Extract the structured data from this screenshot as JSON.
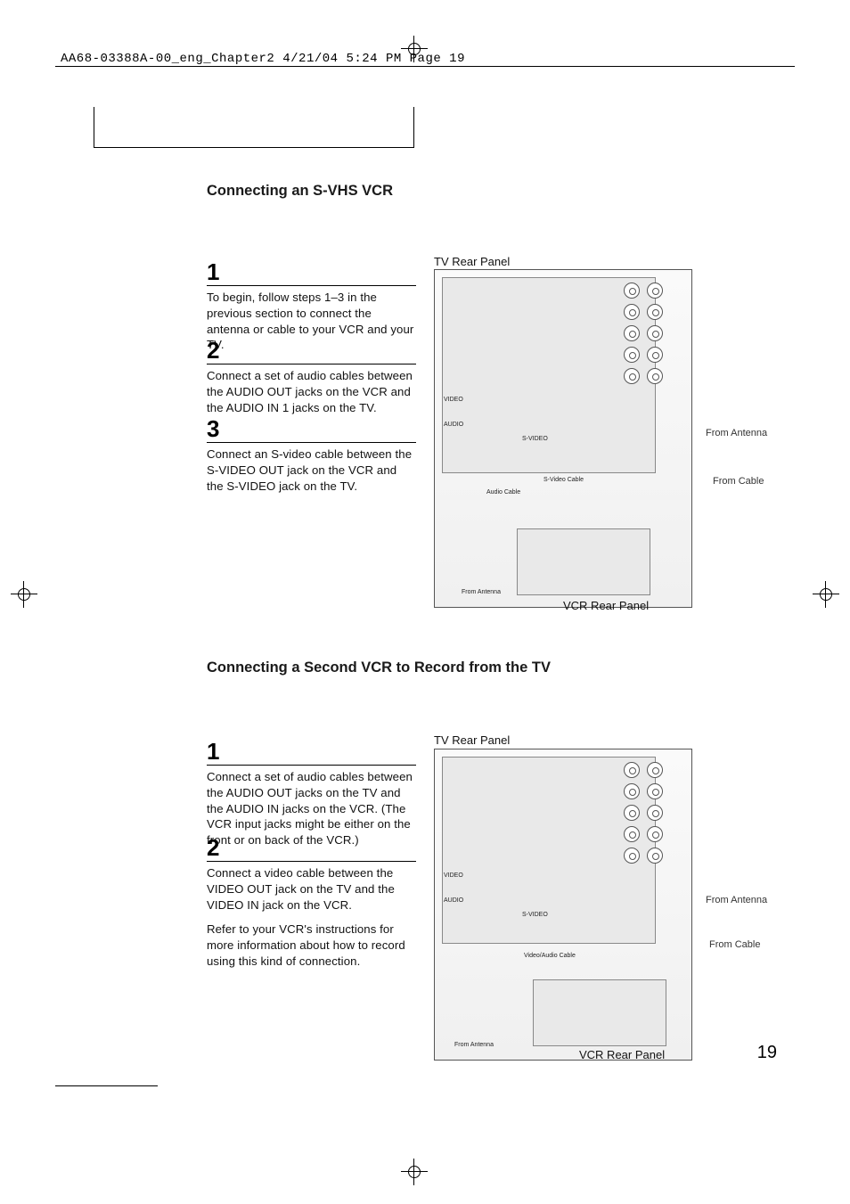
{
  "header": {
    "runhead": "AA68-03388A-00_eng_Chapter2  4/21/04  5:24 PM  Page 19"
  },
  "section1": {
    "heading": "Connecting an S-VHS VCR",
    "diagram_title": "TV Rear Panel",
    "vcr_label": "VCR Rear Panel",
    "from_antenna": "From Antenna",
    "from_cable": "From Cable",
    "svideo_cable": "S-Video Cable",
    "audio_cable": "Audio Cable",
    "steps": [
      {
        "num": "1",
        "text": "To begin, follow steps 1–3 in the previous section to connect the antenna or cable to your VCR and your TV."
      },
      {
        "num": "2",
        "text": "Connect a set of audio cables between the AUDIO OUT jacks on the  VCR and the AUDIO IN 1 jacks on the TV."
      },
      {
        "num": "3",
        "text": "Connect an S-video cable between the S-VIDEO OUT jack on the VCR and the S-VIDEO jack on the TV."
      }
    ]
  },
  "section2": {
    "heading": "Connecting a Second VCR to Record from the TV",
    "diagram_title": "TV Rear Panel",
    "vcr_label": "VCR Rear Panel",
    "from_antenna": "From Antenna",
    "from_cable": "From Cable",
    "va_cable": "Video/Audio Cable",
    "steps": [
      {
        "num": "1",
        "text": "Connect a set of audio cables between the AUDIO OUT jacks on the TV and the AUDIO IN jacks on the VCR. (The VCR input jacks might be either on the front or on back of the VCR.)"
      },
      {
        "num": "2",
        "text": "Connect a video cable between the VIDEO OUT jack on the TV and the VIDEO IN jack on the VCR.",
        "text2": "Refer to your VCR's instructions for more information about how to record using this kind of connection."
      }
    ]
  },
  "page_number": "19"
}
